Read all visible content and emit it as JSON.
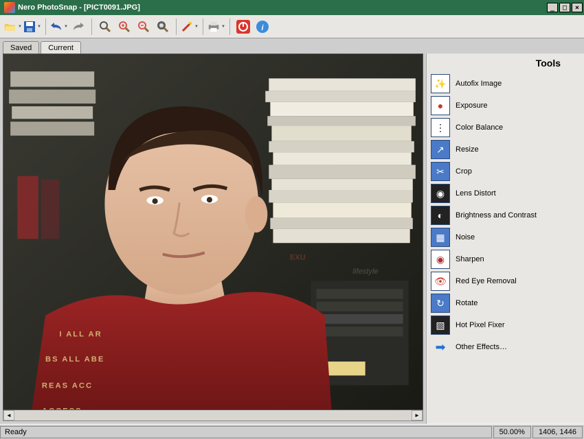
{
  "app": {
    "name": "Nero PhotoSnap",
    "file": "[PICT0091.JPG]"
  },
  "window_controls": {
    "minimize": "_",
    "maximize": "□",
    "close": "×"
  },
  "toolbar": {
    "open": "open-icon",
    "save": "save-icon",
    "undo": "undo-icon",
    "redo": "redo-icon",
    "zoom": "zoom-icon",
    "zoom_in": "zoom-in-icon",
    "zoom_out": "zoom-out-icon",
    "zoom_fit": "zoom-fit-icon",
    "wand": "wand-icon",
    "print": "print-icon",
    "power": "power-icon",
    "info": "info-icon"
  },
  "tabs": {
    "saved": "Saved",
    "current": "Current"
  },
  "tools": {
    "title": "Tools",
    "items": [
      {
        "icon": "autofix-icon",
        "glyph": "✨",
        "bg": "#fff",
        "label": "Autofix Image"
      },
      {
        "icon": "exposure-icon",
        "glyph": "●",
        "bg": "#fff",
        "label": "Exposure"
      },
      {
        "icon": "color-balance-icon",
        "glyph": "⋮",
        "bg": "#fff",
        "label": "Color Balance"
      },
      {
        "icon": "resize-icon",
        "glyph": "↗",
        "bg": "#4a7ac8",
        "label": "Resize"
      },
      {
        "icon": "crop-icon",
        "glyph": "✂",
        "bg": "#4a7ac8",
        "label": "Crop"
      },
      {
        "icon": "lens-distort-icon",
        "glyph": "◉",
        "bg": "#222",
        "label": "Lens Distort"
      },
      {
        "icon": "brightness-contrast-icon",
        "glyph": "◐",
        "bg": "#222",
        "label": "Brightness and Contrast"
      },
      {
        "icon": "noise-icon",
        "glyph": "▦",
        "bg": "#4a7ac8",
        "label": "Noise"
      },
      {
        "icon": "sharpen-icon",
        "glyph": "◉",
        "bg": "#fff",
        "label": "Sharpen"
      },
      {
        "icon": "red-eye-icon",
        "glyph": "👁",
        "bg": "#fff",
        "label": "Red Eye Removal"
      },
      {
        "icon": "rotate-icon",
        "glyph": "↻",
        "bg": "#4a7ac8",
        "label": "Rotate"
      },
      {
        "icon": "hot-pixel-icon",
        "glyph": "▧",
        "bg": "#222",
        "label": "Hot Pixel Fixer"
      },
      {
        "icon": "other-effects-icon",
        "glyph": "➡",
        "bg": "transparent",
        "label": "Other Effects…",
        "arrow": true
      }
    ]
  },
  "statusbar": {
    "ready": "Ready",
    "zoom": "50.00%",
    "dimensions": "1406, 1446"
  },
  "photo": {
    "alt": "Young man in red graphic t-shirt standing in a room with stacked books"
  }
}
